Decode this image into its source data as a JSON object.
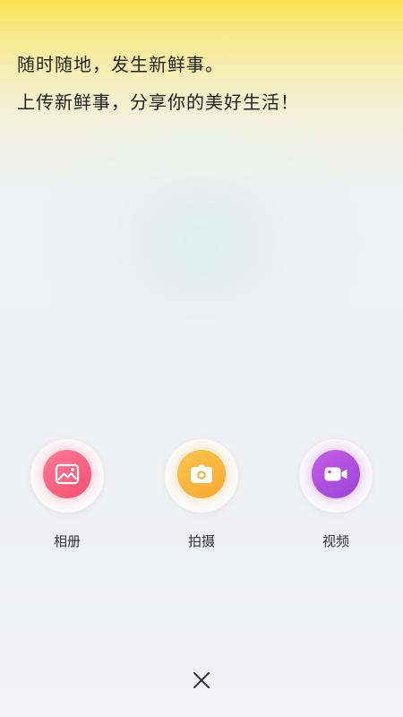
{
  "intro": {
    "line1": "随时随地，发生新鲜事。",
    "line2": "上传新鲜事，分享你的美好生活！"
  },
  "actions": [
    {
      "label": "相册",
      "icon": "image-icon",
      "color": "#fb5f7e"
    },
    {
      "label": "拍摄",
      "icon": "camera-icon",
      "color": "#f9b43a"
    },
    {
      "label": "视频",
      "icon": "video-camera-icon",
      "color": "#b452e0"
    }
  ],
  "close": {
    "icon": "close-icon"
  },
  "colors": {
    "header_yellow": "#fbe151",
    "background": "#eff0f3"
  }
}
